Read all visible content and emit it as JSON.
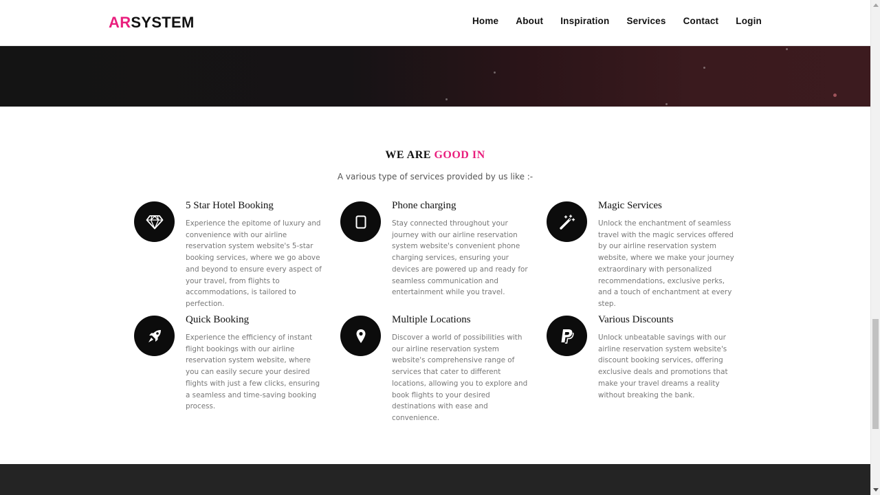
{
  "brand": {
    "prefix": "AR",
    "suffix": "SYSTEM"
  },
  "nav": {
    "items": [
      {
        "label": "Home"
      },
      {
        "label": "About"
      },
      {
        "label": "Inspiration"
      },
      {
        "label": "Services"
      },
      {
        "label": "Contact"
      },
      {
        "label": "Login"
      }
    ]
  },
  "section": {
    "title_plain": "WE ARE",
    "title_accent": "GOOD IN",
    "subtitle": "A various type of services provided by us like :-"
  },
  "services": [
    {
      "icon": "diamond-icon",
      "title": "5 Star Hotel Booking",
      "text": "Experience the epitome of luxury and convenience with our airline reservation system website's 5-star booking services, where we go above and beyond to ensure every aspect of your travel, from flights to accommodations, is tailored to perfection."
    },
    {
      "icon": "tablet-icon",
      "title": "Phone charging",
      "text": "Stay connected throughout your journey with our airline reservation system website's convenient phone charging services, ensuring your devices are powered up and ready for seamless communication and entertainment while you travel."
    },
    {
      "icon": "magic-wand-icon",
      "title": "Magic Services",
      "text": "Unlock the enchantment of seamless travel with the magic services offered by our airline reservation system website, where we make your journey extraordinary with personalized recommendations, exclusive perks, and a touch of enchantment at every step."
    },
    {
      "icon": "rocket-icon",
      "title": "Quick Booking",
      "text": "Experience the efficiency of instant flight bookings with our airline reservation system website, where you can easily secure your desired flights with just a few clicks, ensuring a seamless and time-saving booking process."
    },
    {
      "icon": "map-marker-icon",
      "title": "Multiple Locations",
      "text": "Discover a world of possibilities with our airline reservation system website's comprehensive range of services that cater to different locations, allowing you to explore and book flights to your desired destinations with ease and convenience."
    },
    {
      "icon": "paypal-icon",
      "title": "Various Discounts",
      "text": "Unlock unbeatable savings with our airline reservation system website's discount booking services, offering exclusive deals and promotions that make your travel dreams a reality without breaking the bank."
    }
  ],
  "colors": {
    "accent": "#e91e7d",
    "icon_circle": "#0c0c0c",
    "footer": "#242424"
  }
}
